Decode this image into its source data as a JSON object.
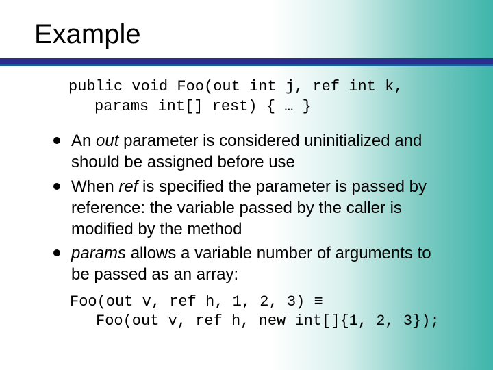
{
  "title": "Example",
  "code1_line1": "public void Foo(out int j, ref int k,",
  "code1_line2": "params int[] rest) { … }",
  "bullets": [
    {
      "t1": "An ",
      "i1": "out",
      "t2": " parameter is considered uninitialized and should be assigned before use"
    },
    {
      "t1": "When ",
      "i1": "ref",
      "t2": " is specified the parameter is passed by reference: the variable passed by the caller is modified by the method"
    },
    {
      "i1": "params",
      "t2": " allows a variable number of arguments to be passed as an array:"
    }
  ],
  "code2_line1": "Foo(out v, ref h, 1, 2, 3) ≡",
  "code2_line2": "Foo(out v, ref h, new int[]{1, 2, 3});"
}
